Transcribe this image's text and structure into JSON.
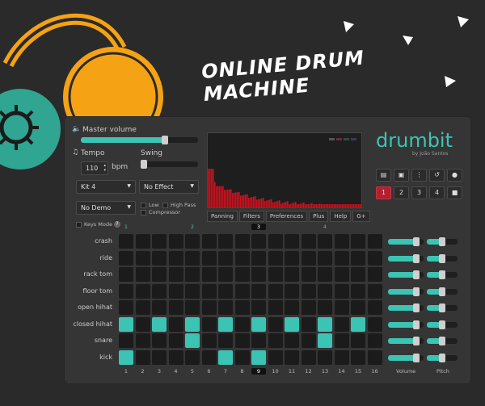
{
  "headline": "ONLINE DRUM MACHINE",
  "colors": {
    "accent": "#3bc4b4",
    "active": "#b02030",
    "headphone": "#f5a215"
  },
  "master": {
    "label": "Master volume",
    "level": 0.72
  },
  "tempo": {
    "label": "Tempo",
    "value": "110",
    "unit": "bpm"
  },
  "swing": {
    "label": "Swing",
    "level": 0.0
  },
  "dropdowns": {
    "kit": "Kit 4",
    "effect": "No Effect",
    "demo": "No Demo"
  },
  "checks": {
    "low": "Low",
    "high_pass": "High Pass",
    "compressor": "Compressor",
    "keys_mode": "Keys Mode",
    "help_icon": "?"
  },
  "tabs": [
    "Panning",
    "Filters",
    "Preferences",
    "Plus",
    "Help",
    "G+"
  ],
  "brand": {
    "logo": "drumbit",
    "byline": "by João Santos"
  },
  "toolbar_icons": [
    "folder-icon",
    "save-icon",
    "more-icon",
    "undo-icon",
    "record-icon"
  ],
  "patterns": [
    "1",
    "2",
    "3",
    "4"
  ],
  "beat_markers": [
    "1",
    "2",
    "3",
    "4"
  ],
  "steps": [
    "1",
    "2",
    "3",
    "4",
    "5",
    "6",
    "7",
    "8",
    "9",
    "10",
    "11",
    "12",
    "13",
    "14",
    "15",
    "16"
  ],
  "current_step": 9,
  "instruments": [
    {
      "name": "crash",
      "steps": [],
      "volume": 0.8,
      "pitch": 0.5
    },
    {
      "name": "ride",
      "steps": [],
      "volume": 0.8,
      "pitch": 0.5
    },
    {
      "name": "rack tom",
      "steps": [],
      "volume": 0.8,
      "pitch": 0.5
    },
    {
      "name": "floor tom",
      "steps": [],
      "volume": 0.8,
      "pitch": 0.5
    },
    {
      "name": "open hihat",
      "steps": [],
      "volume": 0.8,
      "pitch": 0.5
    },
    {
      "name": "closed hihat",
      "steps": [
        1,
        3,
        5,
        7,
        9,
        11,
        13,
        15
      ],
      "volume": 0.8,
      "pitch": 0.5
    },
    {
      "name": "snare",
      "steps": [
        5,
        13
      ],
      "volume": 0.8,
      "pitch": 0.5
    },
    {
      "name": "kick",
      "steps": [
        1,
        7,
        9
      ],
      "volume": 0.8,
      "pitch": 0.5
    }
  ],
  "column_labels": {
    "volume": "Volume",
    "pitch": "Pitch"
  }
}
